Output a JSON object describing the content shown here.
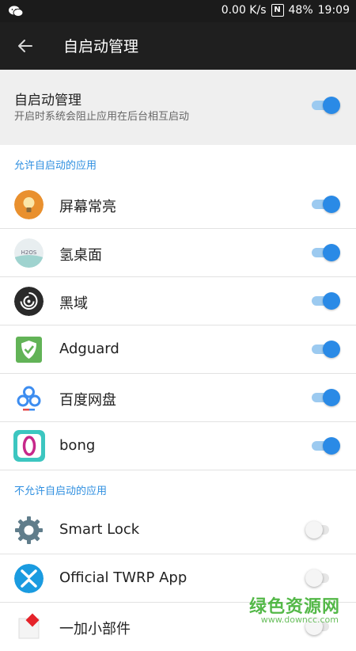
{
  "status_bar": {
    "network_speed": "0.00 K/s",
    "battery": "48%",
    "time": "19:09",
    "nfc_letter": "N"
  },
  "toolbar": {
    "title": "自启动管理"
  },
  "master": {
    "title": "自启动管理",
    "subtitle": "开启时系统会阻止应用在后台相互启动",
    "enabled": true
  },
  "allowed": {
    "header": "允许自启动的应用",
    "apps": [
      {
        "name": "屏幕常亮",
        "icon": "lightbulb-icon",
        "enabled": true
      },
      {
        "name": "氢桌面",
        "icon": "h2os-icon",
        "icon_text": "H2OS",
        "enabled": true
      },
      {
        "name": "黑域",
        "icon": "black-hole-icon",
        "enabled": true
      },
      {
        "name": "Adguard",
        "icon": "shield-icon",
        "enabled": true
      },
      {
        "name": "百度网盘",
        "icon": "baidu-cloud-icon",
        "enabled": true
      },
      {
        "name": "bong",
        "icon": "bong-icon",
        "enabled": true
      }
    ]
  },
  "disallowed": {
    "header": "不允许自启动的应用",
    "apps": [
      {
        "name": "Smart Lock",
        "icon": "gear-icon",
        "enabled": false
      },
      {
        "name": "Official TWRP App",
        "icon": "twrp-icon",
        "enabled": false
      },
      {
        "name": "一加小部件",
        "icon": "widget-icon",
        "enabled": false
      }
    ]
  },
  "watermark": {
    "text": "绿色资源网",
    "url": "www.downcc.com"
  },
  "colors": {
    "accent": "#2a8ae6",
    "section_header": "#2f8fe0",
    "toolbar": "#1f1f1f"
  }
}
